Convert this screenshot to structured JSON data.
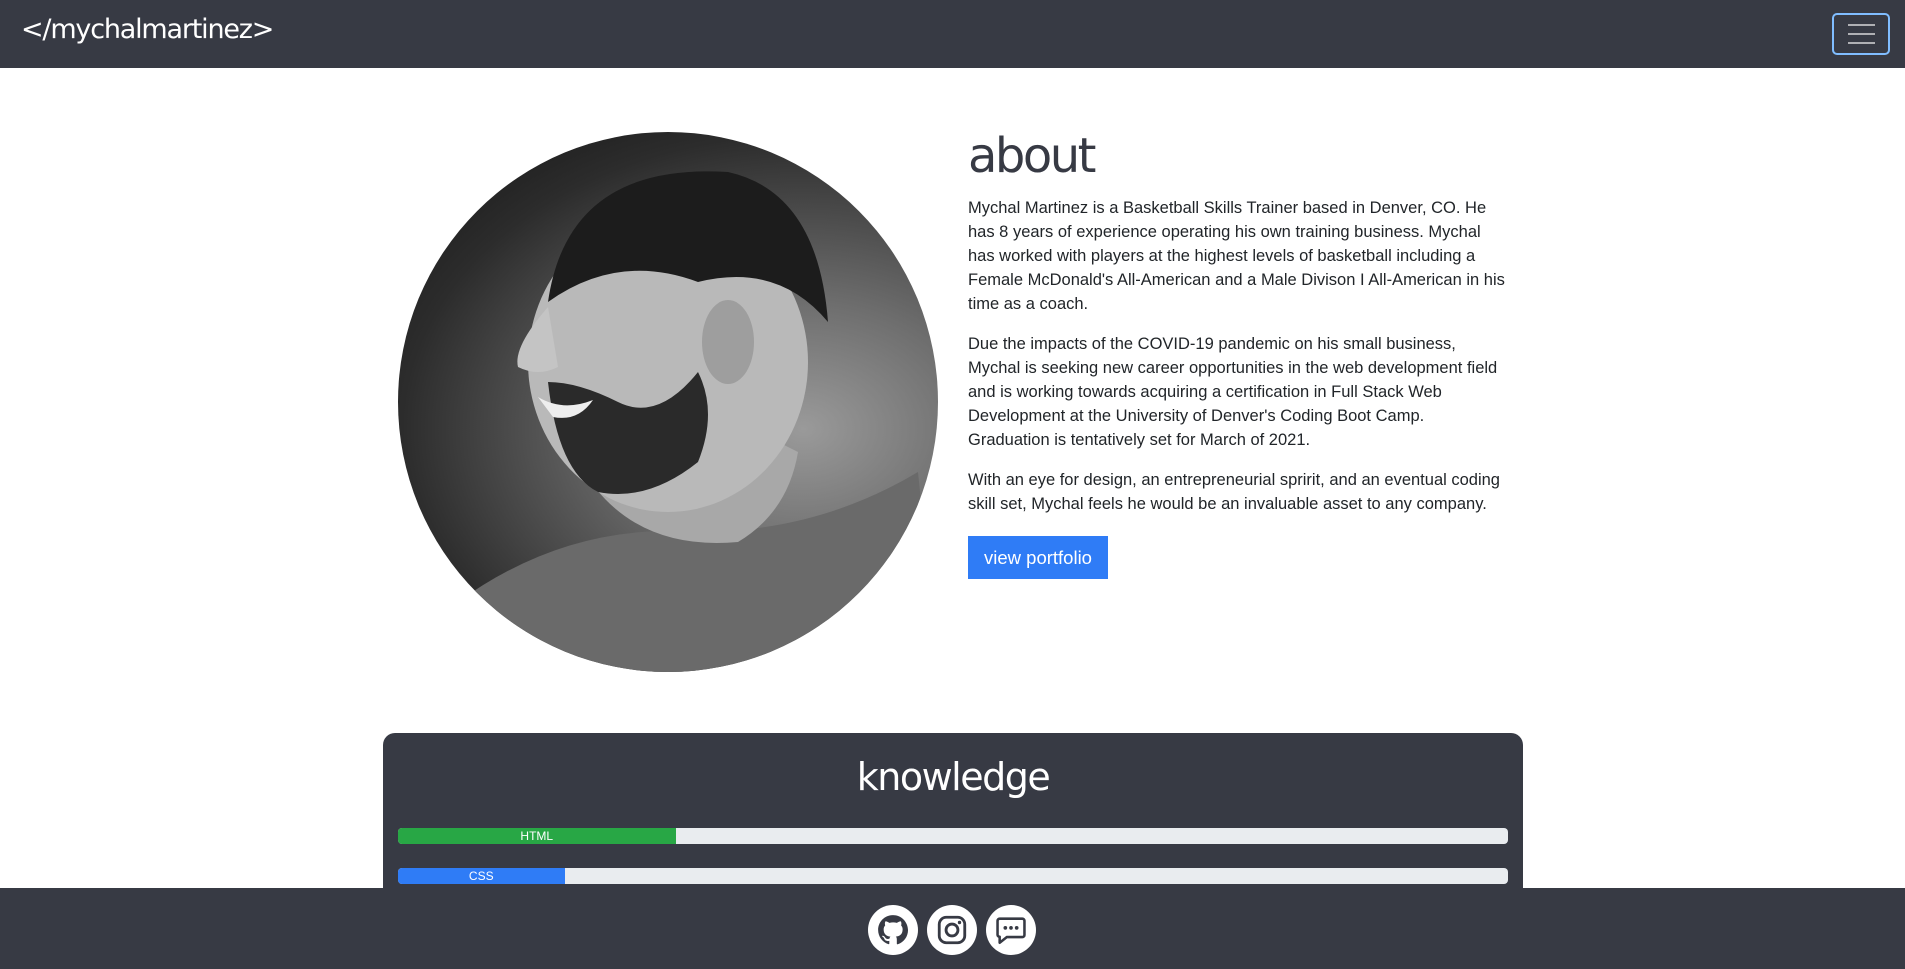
{
  "navbar": {
    "brand": "</mychalmartinez>"
  },
  "about": {
    "heading": "about",
    "paragraphs": [
      "Mychal Martinez is a Basketball Skills Trainer based in Denver, CO. He has 8 years of experience operating his own training business. Mychal has worked with players at the highest levels of basketball including a Female McDonald's All-American and a Male Divison I All-American in his time as a coach.",
      "Due the impacts of the COVID-19 pandemic on his small business, Mychal is seeking new career opportunities in the web development field and is working towards acquiring a certification in Full Stack Web Development at the University of Denver's Coding Boot Camp. Graduation is tentatively set for March of 2021.",
      "With an eye for design, an entrepreneurial spririt, and an eventual coding skill set, Mychal feels he would be an invaluable asset to any company."
    ],
    "button_label": "view portfolio"
  },
  "knowledge": {
    "heading": "knowledge",
    "skills": [
      {
        "label": "HTML",
        "level": 0.25,
        "color": "#28a745"
      },
      {
        "label": "CSS",
        "level": 0.15,
        "color": "#2f7cf6"
      }
    ]
  },
  "footer": {
    "icons": [
      "github-icon",
      "instagram-icon",
      "chat-icon"
    ]
  },
  "colors": {
    "dark": "#373a44",
    "primary": "#2f7cf6",
    "success": "#28a745",
    "toggler_border": "#80bdff"
  }
}
